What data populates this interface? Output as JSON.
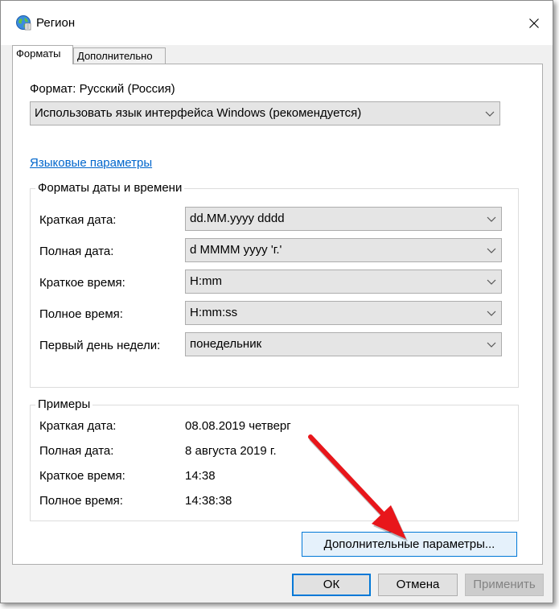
{
  "window": {
    "title": "Регион"
  },
  "tabs": [
    {
      "label": "Форматы",
      "active": true
    },
    {
      "label": "Дополнительно",
      "active": false
    }
  ],
  "format": {
    "label": "Формат: Русский (Россия)",
    "selected": "Использовать язык интерфейса Windows (рекомендуется)"
  },
  "language_link": "Языковые параметры",
  "date_time": {
    "title": "Форматы даты и времени",
    "rows": [
      {
        "label": "Краткая дата:",
        "value": "dd.MM.yyyy dddd"
      },
      {
        "label": "Полная дата:",
        "value": "d MMMM yyyy 'г.'"
      },
      {
        "label": "Краткое время:",
        "value": "H:mm"
      },
      {
        "label": "Полное время:",
        "value": "H:mm:ss"
      },
      {
        "label": "Первый день недели:",
        "value": "понедельник"
      }
    ]
  },
  "examples": {
    "title": "Примеры",
    "rows": [
      {
        "label": "Краткая дата:",
        "value": "08.08.2019 четверг"
      },
      {
        "label": "Полная дата:",
        "value": "8 августа 2019 г."
      },
      {
        "label": "Краткое время:",
        "value": "14:38"
      },
      {
        "label": "Полное время:",
        "value": "14:38:38"
      }
    ]
  },
  "buttons": {
    "additional": "Дополнительные параметры...",
    "ok": "ОК",
    "cancel": "Отмена",
    "apply": "Применить"
  },
  "icons": {
    "app": "globe-icon",
    "close": "close-icon",
    "dropdown": "chevron-down-icon"
  },
  "colors": {
    "link": "#0066cc",
    "arrow": "#e8161b",
    "focus": "#0078d7"
  }
}
